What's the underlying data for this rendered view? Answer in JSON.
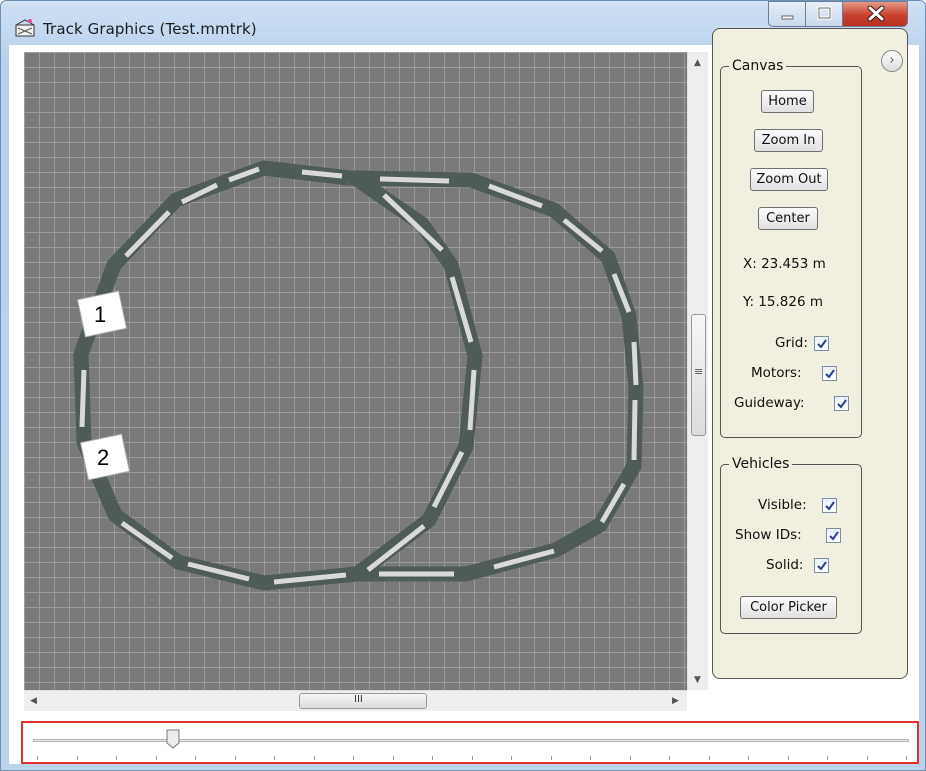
{
  "window": {
    "title": "Track Graphics  (Test.mmtrk)"
  },
  "icons": {
    "app": "track-graphics-app-icon",
    "minimize": "minimize-icon",
    "maximize": "maximize-icon",
    "close": "close-icon",
    "expand": "chevron-right-icon"
  },
  "canvas": {
    "grid_color": "#9a9a9a",
    "background_color": "#7a7a7a",
    "track_color": "#4f5a58",
    "vehicles": [
      {
        "id": "1"
      },
      {
        "id": "2"
      }
    ]
  },
  "scrollbars": {
    "vertical_grip": "≡",
    "horizontal_grip": "III"
  },
  "panel": {
    "canvas_group": {
      "legend": "Canvas",
      "home_label": "Home",
      "zoom_in_label": "Zoom In",
      "zoom_out_label": "Zoom Out",
      "center_label": "Center",
      "x_readout": "X: 23.453  m",
      "y_readout": "Y: 15.826  m",
      "grid_label": "Grid:",
      "grid_checked": true,
      "motors_label": "Motors:",
      "motors_checked": true,
      "guideway_label": "Guideway:",
      "guideway_checked": true
    },
    "vehicles_group": {
      "legend": "Vehicles",
      "visible_label": "Visible:",
      "visible_checked": true,
      "show_ids_label": "Show IDs:",
      "show_ids_checked": true,
      "solid_label": "Solid:",
      "solid_checked": true,
      "color_picker_label": "Color Picker"
    }
  },
  "timeline": {
    "position_fraction": 0.16,
    "highlight_color": "#e03030"
  }
}
